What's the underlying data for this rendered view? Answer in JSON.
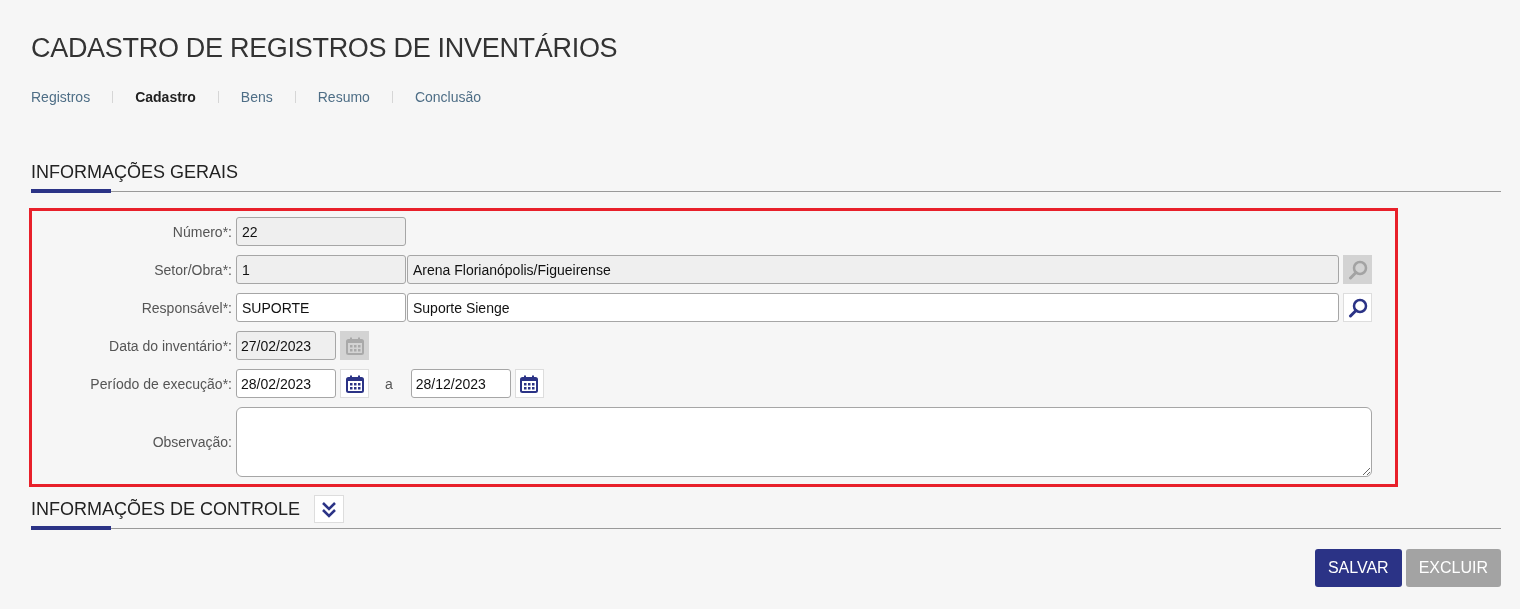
{
  "page_title": "CADASTRO DE REGISTROS DE INVENTÁRIOS",
  "tabs": [
    {
      "label": "Registros",
      "selected": false
    },
    {
      "label": "Cadastro",
      "selected": true
    },
    {
      "label": "Bens",
      "selected": false
    },
    {
      "label": "Resumo",
      "selected": false
    },
    {
      "label": "Conclusão",
      "selected": false
    }
  ],
  "general_section": {
    "title": "INFORMAÇÕES GERAIS",
    "highlighted": true,
    "fields": [
      {
        "kind": "text",
        "label": "Número*:",
        "value": "22",
        "disabled": true
      },
      {
        "kind": "lookup",
        "label": "Setor/Obra*:",
        "code": "1",
        "description": "Arena Florianópolis/Figueirense",
        "disabled": true
      },
      {
        "kind": "lookup",
        "label": "Responsável*:",
        "code": "SUPORTE",
        "description": "Suporte Sienge",
        "disabled": false
      },
      {
        "kind": "date",
        "label": "Data do inventário*:",
        "value": "27/02/2023",
        "disabled": true
      },
      {
        "kind": "daterange",
        "label": "Período de execução*:",
        "start": "28/02/2023",
        "separator": "a",
        "end": "28/12/2023",
        "disabled": false
      },
      {
        "kind": "textarea",
        "label": "Observação:",
        "disabled": false
      }
    ]
  },
  "control_section": {
    "title": "INFORMAÇÕES DE CONTROLE",
    "expanded": false
  },
  "buttons": [
    {
      "label": "SALVAR",
      "disabled": false
    },
    {
      "label": "EXCLUIR",
      "disabled": true
    }
  ]
}
